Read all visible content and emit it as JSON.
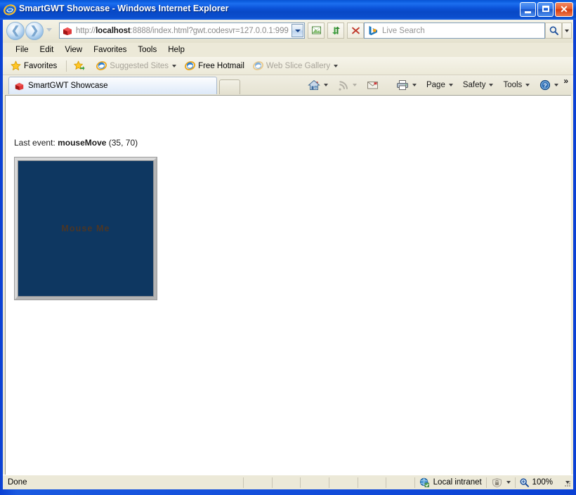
{
  "window": {
    "title": "SmartGWT Showcase - Windows Internet Explorer",
    "icon": "internet-explorer-icon",
    "controls": {
      "minimize": "Minimize",
      "maximize": "Maximize",
      "close": "Close"
    }
  },
  "navbar": {
    "back": "Back",
    "forward": "Forward",
    "recent_pages": "Recent Pages",
    "address": {
      "icon": "smartgwt-page-icon",
      "scheme": "http://",
      "host": "localhost",
      "rest": ":8888/index.html?gwt.codesvr=127.0.0.1:999",
      "full": "http://localhost:8888/index.html?gwt.codesvr=127.0.0.1:999",
      "dropdown": "Address dropdown"
    },
    "compatibility_button": "compatibility-view-icon",
    "refresh_button": "refresh-icon",
    "stop_button": "stop-icon",
    "search": {
      "placeholder": "Live Search",
      "provider_icon": "bing-icon",
      "go_button": "search-icon",
      "options_button": "search-options"
    }
  },
  "menubar": {
    "items": [
      {
        "label": "File"
      },
      {
        "label": "Edit"
      },
      {
        "label": "View"
      },
      {
        "label": "Favorites"
      },
      {
        "label": "Tools"
      },
      {
        "label": "Help"
      }
    ]
  },
  "favbar": {
    "favorites_label": "Favorites",
    "items": [
      {
        "label": "Suggested Sites",
        "icon": "ie-icon",
        "dim": true,
        "caret": true
      },
      {
        "label": "Free Hotmail",
        "icon": "ie-icon",
        "dim": false,
        "caret": false
      },
      {
        "label": "Web Slice Gallery",
        "icon": "ie-icon",
        "dim": true,
        "caret": true
      }
    ]
  },
  "tabs": {
    "items": [
      {
        "label": "SmartGWT Showcase",
        "icon": "smartgwt-page-icon",
        "active": true
      }
    ],
    "new_tab": "New Tab"
  },
  "command_bar": {
    "home": "Home",
    "feeds": "Feeds",
    "read_mail": "Read Mail",
    "print": "Print",
    "page": "Page",
    "safety": "Safety",
    "tools": "Tools",
    "help": "Help",
    "overflow": "»"
  },
  "page": {
    "event_label": "Last event:",
    "event_name": "mouseMove",
    "event_coords": "(35, 70)",
    "canvas": {
      "label": "Mouse Me",
      "bg_color": "#0e3761",
      "label_color": "#4b3626",
      "border_color": "#c6c6c6"
    }
  },
  "statusbar": {
    "status": "Done",
    "zone": "Local intranet",
    "zone_icon": "globe-icon",
    "protected_mode_icon": "security-lock-icon",
    "zoom_icon": "zoom-icon",
    "zoom": "100%"
  }
}
